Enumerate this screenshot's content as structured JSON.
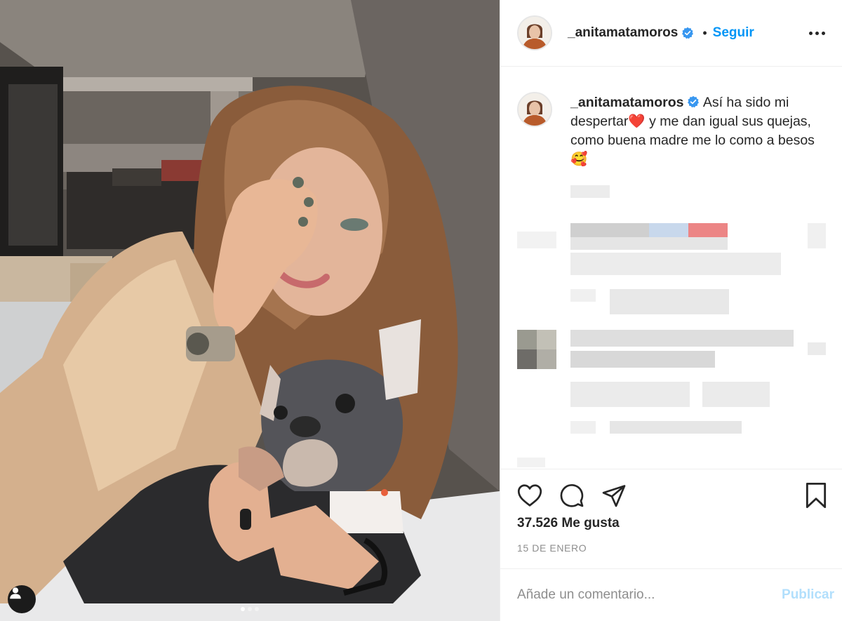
{
  "post": {
    "username": "_anitamatamoros",
    "separator": "•",
    "follow_label": "Seguir",
    "caption": {
      "username": "_anitamatamoros",
      "text_1": " Así ha sido mi despertar",
      "emoji_1": "❤️",
      "text_2": " y me dan igual sus quejas, como buena madre me lo como a besos",
      "emoji_2": "🥰"
    },
    "likes": "37.526 Me gusta",
    "date": "15 DE ENERO",
    "comment_placeholder": "Añade un comentario...",
    "publish_label": "Publicar",
    "carousel_pages": 3,
    "carousel_active": 1
  },
  "colors": {
    "accent": "#0095f6",
    "publish_disabled": "#b2dffc",
    "verified": "#3897f0"
  },
  "icons": {
    "like": "heart-icon",
    "comment": "comment-icon",
    "share": "paper-plane-icon",
    "save": "bookmark-icon",
    "more": "more-options-icon",
    "user_tag": "user-tag-icon"
  }
}
